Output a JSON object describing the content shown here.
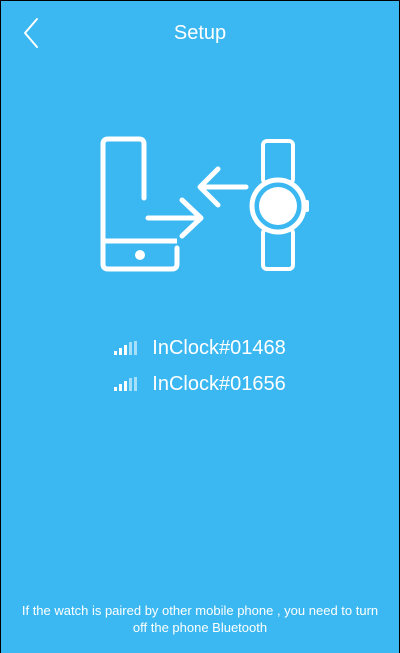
{
  "header": {
    "title": "Setup",
    "back_icon": "chevron-left-icon"
  },
  "illustration": {
    "icons": [
      "phone-icon",
      "transfer-arrows-icon",
      "watch-icon"
    ]
  },
  "devices": [
    {
      "name": "InClock#01468",
      "signal_icon": "signal-strength-icon"
    },
    {
      "name": "InClock#01656",
      "signal_icon": "signal-strength-icon"
    }
  ],
  "footer": {
    "note": "If the watch is paired by other mobile phone , you need to turn off the phone Bluetooth"
  },
  "colors": {
    "background": "#3bb8f2",
    "foreground": "#ffffff"
  }
}
